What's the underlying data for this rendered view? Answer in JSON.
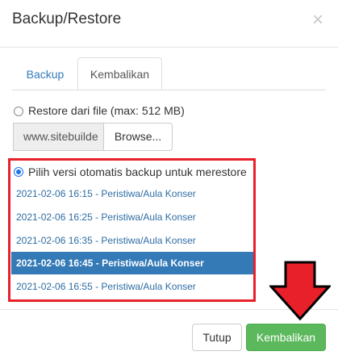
{
  "dialog": {
    "title": "Backup/Restore",
    "close_icon": "×"
  },
  "tabs": [
    {
      "label": "Backup",
      "active": false
    },
    {
      "label": "Kembalikan",
      "active": true
    }
  ],
  "restore_file": {
    "label": "Restore dari file (max: 512 MB)",
    "checked": false,
    "file_value": "www.sitebuilde",
    "browse_label": "Browse..."
  },
  "auto_backup": {
    "label": "Pilih versi otomatis backup untuk merestore",
    "checked": true,
    "items": [
      {
        "label": "2021-02-06 16:15 - Peristiwa/Aula Konser",
        "selected": false
      },
      {
        "label": "2021-02-06 16:25 - Peristiwa/Aula Konser",
        "selected": false
      },
      {
        "label": "2021-02-06 16:35 - Peristiwa/Aula Konser",
        "selected": false
      },
      {
        "label": "2021-02-06 16:45 - Peristiwa/Aula Konser",
        "selected": true
      },
      {
        "label": "2021-02-06 16:55 - Peristiwa/Aula Konser",
        "selected": false
      }
    ]
  },
  "footer": {
    "close_label": "Tutup",
    "restore_label": "Kembalikan"
  },
  "colors": {
    "highlight_box": "#e8202a",
    "selected_row": "#337ab7",
    "primary_button": "#5cb85c",
    "annotation_arrow": "#e8202a"
  },
  "icons": {
    "annotation": "red-down-arrow-icon"
  }
}
